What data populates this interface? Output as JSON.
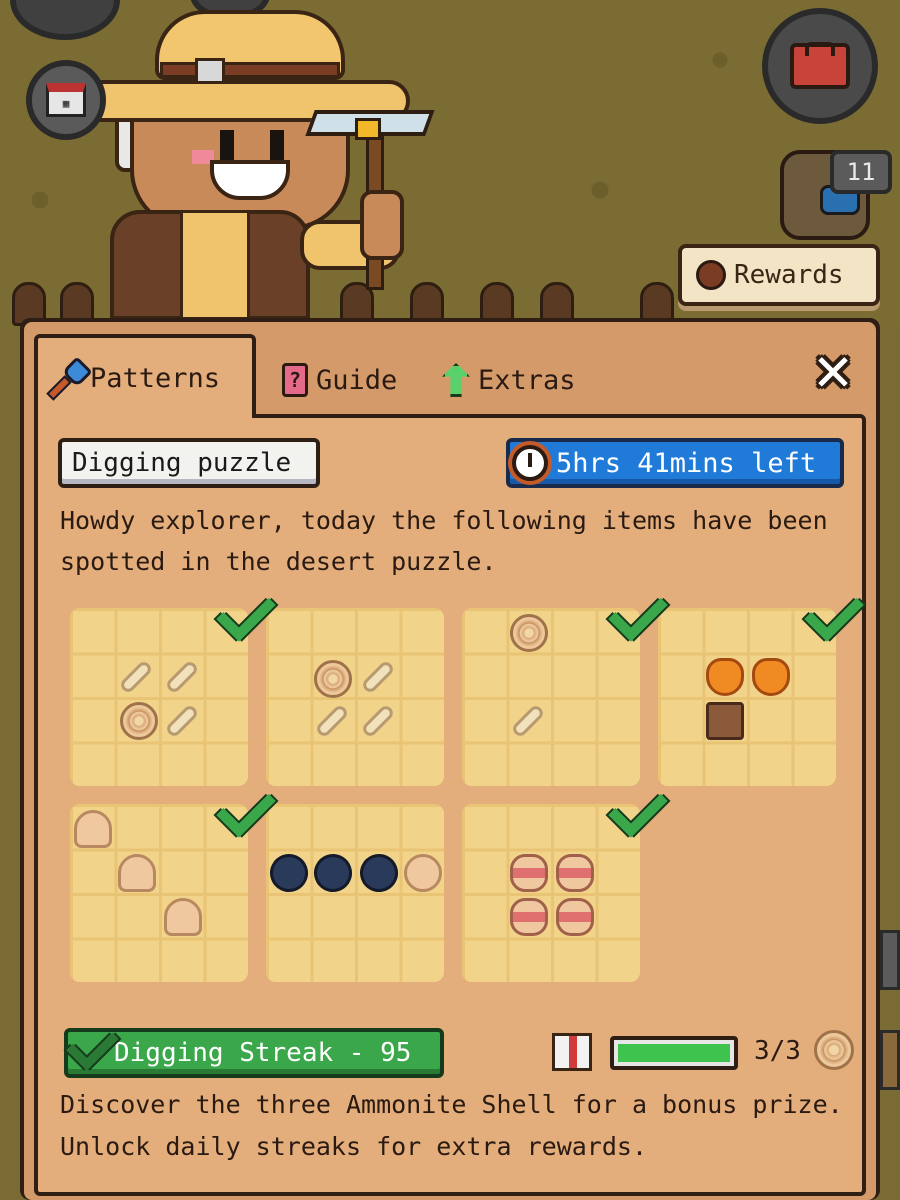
{
  "hud": {
    "badge_count": "11",
    "rewards_label": "Rewards"
  },
  "tabs": [
    {
      "label": "Patterns",
      "active": true,
      "icon": "shovel-icon"
    },
    {
      "label": "Guide",
      "active": false,
      "icon": "question-icon"
    },
    {
      "label": "Extras",
      "active": false,
      "icon": "green-gem-icon"
    }
  ],
  "panel": {
    "title_label": "Digging puzzle",
    "timer": "5hrs 41mins left",
    "intro": "Howdy explorer, today the following items have been spotted in the desert puzzle.",
    "puzzles": [
      {
        "completed": true,
        "items": [
          "bone",
          "bone",
          "ammonite",
          "bone"
        ]
      },
      {
        "completed": false,
        "items": [
          "ammonite",
          "bone",
          "bone",
          "bone"
        ]
      },
      {
        "completed": true,
        "items": [
          "ammonite",
          "bone"
        ]
      },
      {
        "completed": true,
        "items": [
          "pot",
          "pot",
          "tablet"
        ]
      },
      {
        "completed": true,
        "items": [
          "shell-dome",
          "shell-dome",
          "shell-dome"
        ]
      },
      {
        "completed": false,
        "items": [
          "coal",
          "coal",
          "coal",
          "clam"
        ]
      },
      {
        "completed": true,
        "items": [
          "clam-red",
          "clam-red",
          "clam-red",
          "clam-red"
        ]
      }
    ],
    "streak_label": "Digging Streak - 95",
    "progress": {
      "current": 3,
      "total": 3,
      "text": "3/3",
      "fraction": 1.0
    },
    "outro": "Discover the three Ammonite Shell for a bonus prize. Unlock daily streaks for extra rewards."
  },
  "colors": {
    "panel_bg": "#e3ae7b",
    "timer_blue": "#1f7ad8",
    "streak_green": "#3aa84a",
    "check_green": "#3aa84a"
  }
}
